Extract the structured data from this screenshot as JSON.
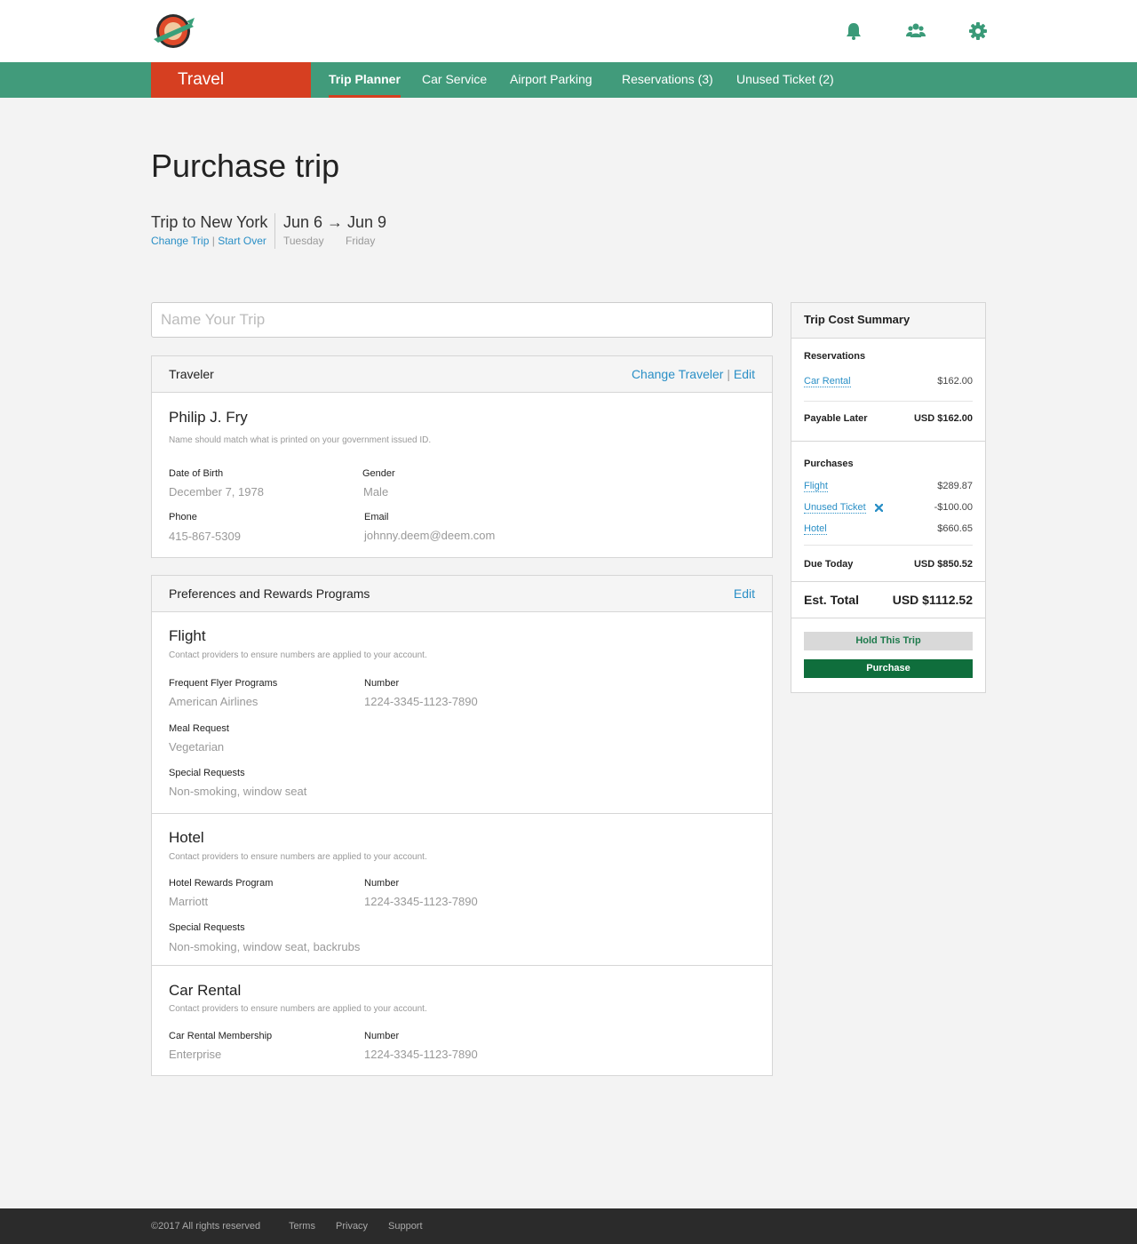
{
  "header": {
    "logo_alt": "Planet Express",
    "icons": [
      "bell-icon",
      "users-icon",
      "gear-icon"
    ]
  },
  "nav": {
    "brand": "Travel",
    "items": [
      {
        "label": "Trip Planner",
        "active": true
      },
      {
        "label": "Car Service"
      },
      {
        "label": "Airport Parking"
      },
      {
        "label": "Reservations (3)"
      },
      {
        "label": "Unused Ticket (2)"
      }
    ]
  },
  "page": {
    "title": "Purchase trip",
    "trip_name": "Trip to New York",
    "change_trip": "Change Trip",
    "sep": "|",
    "start_over": "Start Over",
    "dates": "Jun 6 → Jun 9",
    "start_day": "Tuesday",
    "end_day": "Friday",
    "name_placeholder": "Name Your Trip"
  },
  "traveler": {
    "heading": "Traveler",
    "change_traveler": "Change Traveler",
    "sep": "|",
    "edit": "Edit",
    "name": "Philip J. Fry",
    "note": "Name should match what is printed on your government issued ID.",
    "dob_label": "Date of Birth",
    "dob": "December 7, 1978",
    "gender_label": "Gender",
    "gender": "Male",
    "phone_label": "Phone",
    "phone": "415-867-5309",
    "email_label": "Email",
    "email": "johnny.deem@deem.com"
  },
  "preferences": {
    "heading": "Preferences and Rewards Programs",
    "edit": "Edit",
    "note": "Contact providers to ensure numbers are applied to your account.",
    "flight": {
      "title": "Flight",
      "program_label": "Frequent Flyer Programs",
      "program": "American Airlines",
      "number_label": "Number",
      "number": "1224-3345-1123-7890",
      "meal_label": "Meal Request",
      "meal": "Vegetarian",
      "special_label": "Special Requests",
      "special": "Non-smoking, window seat"
    },
    "hotel": {
      "title": "Hotel",
      "program_label": "Hotel Rewards Program",
      "program": "Marriott",
      "number_label": "Number",
      "number": "1224-3345-1123-7890",
      "special_label": "Special Requests",
      "special": "Non-smoking, window seat, backrubs"
    },
    "car": {
      "title": "Car Rental",
      "program_label": "Car Rental Membership",
      "program": "Enterprise",
      "number_label": "Number",
      "number": "1224-3345-1123-7890"
    }
  },
  "summary": {
    "heading": "Trip Cost Summary",
    "reservations_label": "Reservations",
    "car_rental": "Car Rental",
    "car_rental_amt": "$162.00",
    "payable_later_label": "Payable Later",
    "payable_later": "USD $162.00",
    "purchases_label": "Purchases",
    "flight": "Flight",
    "flight_amt": "$289.87",
    "unused_ticket": "Unused Ticket",
    "unused_ticket_amt": "-$100.00",
    "hotel": "Hotel",
    "hotel_amt": "$660.65",
    "due_today_label": "Due Today",
    "due_today": "USD $850.52",
    "est_total_label": "Est. Total",
    "est_total": "USD $1112.52",
    "hold_button": "Hold This Trip",
    "purchase_button": "Purchase",
    "colors": {
      "hold_text": "#1e7a4c",
      "purchase_bg": "#0f6e3c"
    }
  },
  "footer": {
    "copyright": "©2017 All rights reserved",
    "terms": "Terms",
    "privacy": "Privacy",
    "support": "Support"
  },
  "colors": {
    "nav_bg": "#419b7b",
    "brand_bg": "#d63f21",
    "link": "#2a8fc6",
    "footer_bg": "#2b2b2b"
  }
}
